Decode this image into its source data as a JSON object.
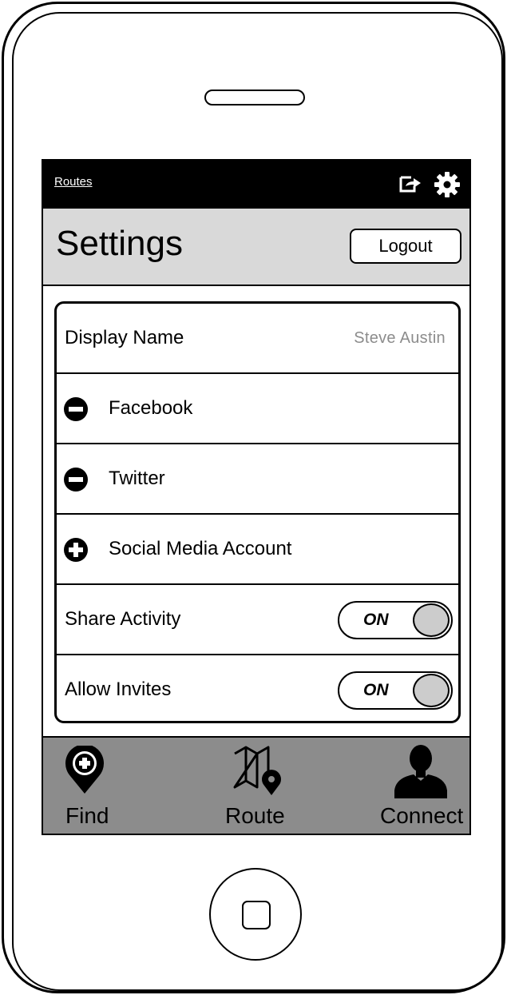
{
  "status_bar": {
    "back_link": "Routes",
    "share_icon": "share-icon",
    "settings_icon": "gear-icon"
  },
  "header": {
    "title": "Settings",
    "logout_label": "Logout"
  },
  "settings": {
    "display_name_label": "Display Name",
    "display_name_value": "Steve Austin",
    "accounts": [
      {
        "label": "Facebook",
        "icon": "remove-circle-icon"
      },
      {
        "label": "Twitter",
        "icon": "remove-circle-icon"
      },
      {
        "label": "Social Media Account",
        "icon": "add-circle-icon"
      }
    ],
    "toggles": [
      {
        "label": "Share Activity",
        "state": "ON"
      },
      {
        "label": "Allow Invites",
        "state": "ON"
      }
    ]
  },
  "tab_bar": {
    "tabs": [
      {
        "label": "Find",
        "icon": "map-pin-plus-icon"
      },
      {
        "label": "Route",
        "icon": "map-route-icon"
      },
      {
        "label": "Connect",
        "icon": "person-icon"
      }
    ]
  },
  "colors": {
    "status_bar": "#000000",
    "title_bar": "#d9d9d9",
    "tab_bar": "#8c8c8c",
    "toggle_knob": "#cccccc",
    "muted_text": "#8c8c8c"
  }
}
